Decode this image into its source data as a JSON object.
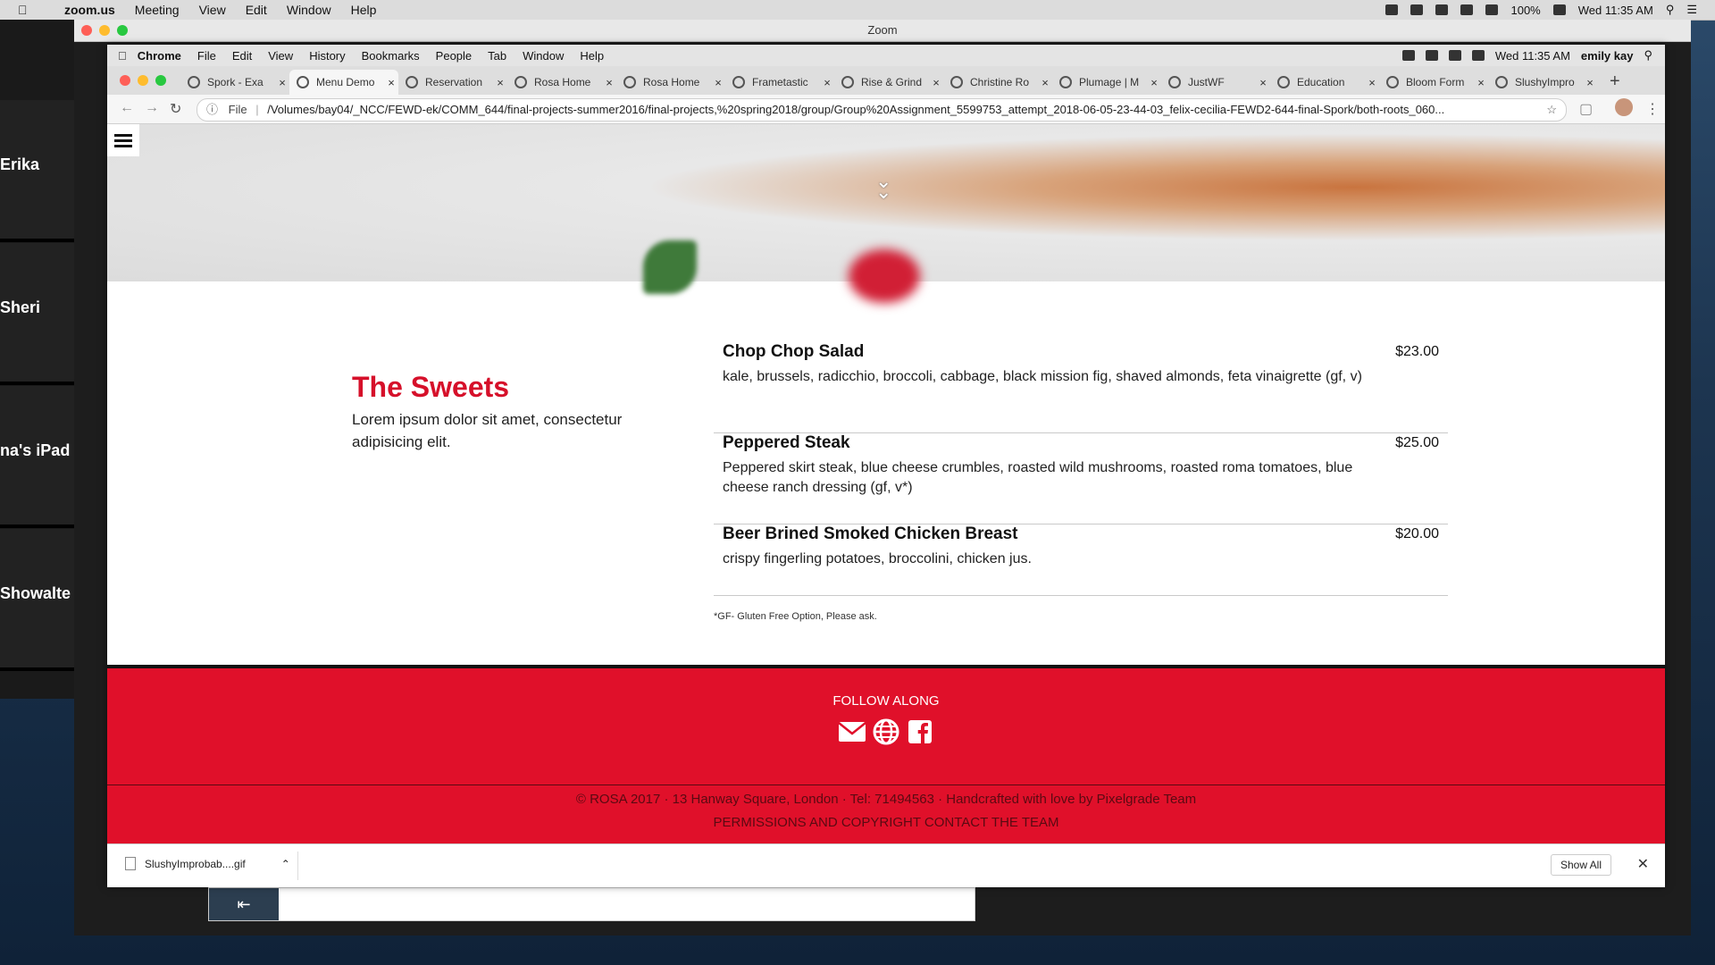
{
  "menubar": {
    "app": "zoom.us",
    "items": [
      "Meeting",
      "View",
      "Edit",
      "Window",
      "Help"
    ],
    "battery": "100%",
    "clock": "Wed 11:35 AM"
  },
  "zoom": {
    "title": "Zoom"
  },
  "participants": [
    "Erika",
    "Sheri",
    "na's iPad",
    "Showalte"
  ],
  "chrome": {
    "menu": [
      "Chrome",
      "File",
      "Edit",
      "View",
      "History",
      "Bookmarks",
      "People",
      "Tab",
      "Window",
      "Help"
    ],
    "clock": "Wed 11:35 AM",
    "user": "emily kay",
    "tabs": [
      {
        "title": "Spork - Exa",
        "active": false
      },
      {
        "title": "Menu Demo",
        "active": true
      },
      {
        "title": "Reservation",
        "active": false
      },
      {
        "title": "Rosa Home",
        "active": false
      },
      {
        "title": "Rosa Home",
        "active": false
      },
      {
        "title": "Frametastic",
        "active": false
      },
      {
        "title": "Rise & Grind",
        "active": false
      },
      {
        "title": "Christine Ro",
        "active": false
      },
      {
        "title": "Plumage | M",
        "active": false
      },
      {
        "title": "JustWF",
        "active": false
      },
      {
        "title": "Education",
        "active": false
      },
      {
        "title": "Bloom Form",
        "active": false
      },
      {
        "title": "SlushyImpro",
        "active": false
      }
    ],
    "url_prefix": "File",
    "url": "/Volumes/bay04/_NCC/FEWD-ek/COMM_644/final-projects-summer2016/final-projects,%20spring2018/group/Group%20Assignment_5599753_attempt_2018-06-05-23-44-03_felix-cecilia-FEWD2-644-final-Spork/both-roots_060..."
  },
  "page": {
    "section_title": "The Sweets",
    "section_desc": "Lorem ipsum dolor sit amet, consectetur adipisicing elit.",
    "menu_items": [
      {
        "name": "Chop Chop Salad",
        "price": "$23.00",
        "desc": "kale, brussels, radicchio, broccoli, cabbage, black mission fig, shaved almonds, feta vinaigrette (gf, v)"
      },
      {
        "name": "Peppered Steak",
        "price": "$25.00",
        "desc": "Peppered skirt steak, blue cheese crumbles, roasted wild mushrooms, roasted roma tomatoes, blue cheese ranch dressing (gf, v*)"
      },
      {
        "name": "Beer Brined Smoked Chicken Breast",
        "price": "$20.00",
        "desc": "crispy fingerling potatoes, broccolini, chicken jus."
      }
    ],
    "note": "*GF- Gluten Free Option, Please ask.",
    "footer": {
      "follow": "FOLLOW ALONG",
      "social_icons": [
        "mail-icon",
        "globe-icon",
        "facebook-icon"
      ],
      "copyright": "© ROSA 2017 · 13 Hanway Square, London · Tel: 71494563 · Handcrafted with love by Pixelgrade Team",
      "links": "PERMISSIONS AND COPYRIGHT CONTACT THE TEAM"
    }
  },
  "download": {
    "file": "SlushyImprobab....gif",
    "show_all": "Show All"
  },
  "colors": {
    "accent": "#e0102a",
    "title_red": "#d6102a"
  }
}
